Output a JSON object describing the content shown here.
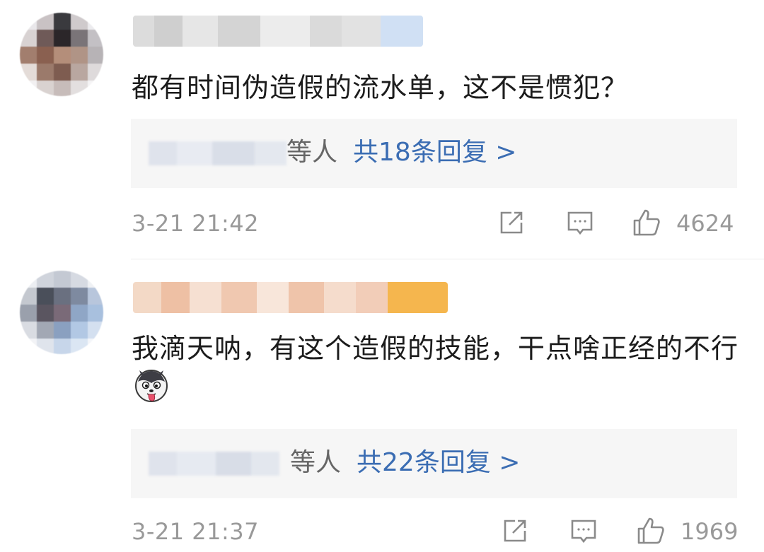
{
  "comments": [
    {
      "text": "都有时间伪造假的流水单，这不是惯犯？",
      "reply_suffix": "等人",
      "reply_count_label": "共18条回复 >",
      "time": "3-21 21:42",
      "likes": "4624"
    },
    {
      "text": "我滴天呐，有这个造假的技能，干点啥正经的不行",
      "reply_suffix": "等人",
      "reply_count_label": "共22条回复 >",
      "time": "3-21 21:37",
      "likes": "1969"
    }
  ],
  "icons": {
    "share": "share-icon",
    "comment": "comment-icon",
    "like": "thumbs-up-icon",
    "emoji": "husky-tongue-emoji"
  },
  "colors": {
    "link": "#3b6db3",
    "meta": "#999999",
    "reply_bg": "#f6f6f6"
  }
}
